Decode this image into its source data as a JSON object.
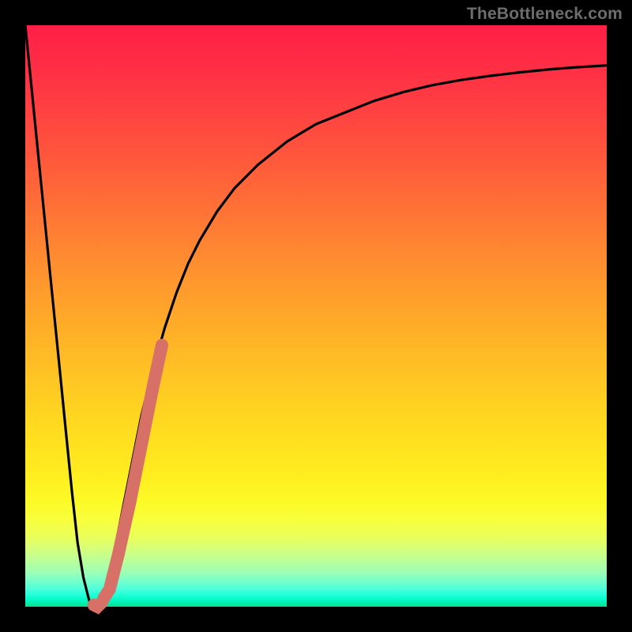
{
  "watermark": "TheBottleneck.com",
  "colors": {
    "frame": "#000000",
    "curve": "#000000",
    "highlight": "#d77168"
  },
  "chart_data": {
    "type": "line",
    "title": "",
    "xlabel": "",
    "ylabel": "",
    "xlim": [
      0,
      100
    ],
    "ylim": [
      0,
      100
    ],
    "grid": false,
    "legend": false,
    "note": "Axes unlabeled in source; values estimated from pixel positions on a 0–100 normalized scale.",
    "series": [
      {
        "name": "main-curve",
        "x": [
          0,
          1,
          2,
          3,
          4,
          5,
          6,
          7,
          8,
          9,
          10,
          11,
          12,
          13,
          14,
          15,
          16,
          17,
          18,
          19,
          20,
          22,
          24,
          26,
          28,
          30,
          33,
          36,
          40,
          45,
          50,
          55,
          60,
          65,
          70,
          75,
          80,
          85,
          90,
          95,
          100
        ],
        "y": [
          100,
          90,
          80,
          70,
          60,
          50,
          40,
          30,
          20,
          11,
          5,
          1,
          0,
          1,
          4,
          8,
          13,
          18,
          23,
          28,
          33,
          41,
          48,
          54,
          59,
          63,
          68,
          72,
          76,
          80,
          83,
          85,
          87,
          88.5,
          89.7,
          90.6,
          91.3,
          91.9,
          92.4,
          92.8,
          93.1
        ]
      },
      {
        "name": "highlight-segment",
        "x": [
          13.5,
          14.5,
          16,
          18,
          20,
          22,
          23.5
        ],
        "y": [
          1.5,
          3,
          9,
          18,
          28,
          38,
          45
        ]
      },
      {
        "name": "highlight-hook",
        "x": [
          11.8,
          12.4,
          13.2
        ],
        "y": [
          0.3,
          0.0,
          0.8
        ]
      }
    ]
  }
}
